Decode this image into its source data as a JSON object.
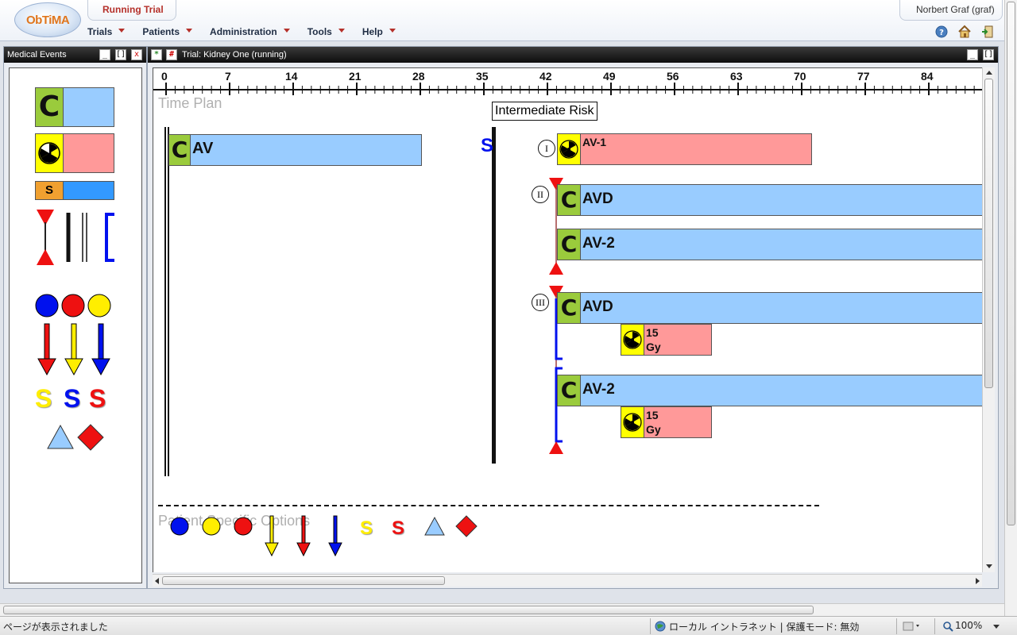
{
  "app": {
    "logo_text": "ObTiMA",
    "active_tab": "Running Trial",
    "user": "Norbert Graf (graf)"
  },
  "menu": [
    {
      "label": "Trials"
    },
    {
      "label": "Patients"
    },
    {
      "label": "Administration"
    },
    {
      "label": "Tools"
    },
    {
      "label": "Help"
    }
  ],
  "header_icons": [
    "help-icon",
    "home-icon",
    "logout-icon"
  ],
  "left_panel": {
    "title": "Medical Events",
    "buttons": {
      "minimize": "_",
      "restore": "[]",
      "close": "x"
    }
  },
  "main_panel": {
    "title": "Trial: Kidney One (running)",
    "add_button": "*",
    "hash_button": "#",
    "buttons": {
      "minimize": "_",
      "restore": "[]"
    }
  },
  "timeline": {
    "ticks": [
      "0",
      "7",
      "14",
      "21",
      "28",
      "35",
      "42",
      "49",
      "56",
      "63",
      "70",
      "77",
      "84"
    ],
    "section_title": "Time Plan",
    "risk_label": "Intermediate Risk",
    "s_marker": "S",
    "chemo_letter": "C",
    "av_label": "AV",
    "branches": [
      {
        "roman": "I",
        "label": "AV-1"
      },
      {
        "roman": "II",
        "label_1": "AVD",
        "label_2": "AV-2"
      },
      {
        "roman": "III",
        "label_1": "AVD",
        "label_2": "AV-2",
        "dose_value": "15",
        "dose_unit": "Gy"
      }
    ],
    "patient_options_title": "Patient Specific Options",
    "s_letters": [
      "S",
      "S"
    ]
  },
  "palette": {
    "chemo_letter": "C",
    "s_letter": "S",
    "s_letters": [
      "S",
      "S",
      "S"
    ]
  },
  "colors": {
    "chemo": "#99ccff",
    "chemo_label": "#9acb3c",
    "radio": "#ff9999",
    "radiation_icon": "#ffff00",
    "surgery_label": "#f0a030",
    "surgery_bar": "#3399ff",
    "red": "#ee1111",
    "blue": "#0000ee",
    "yellow": "#ffee00"
  },
  "statusbar": {
    "left": "ページが表示されました",
    "zone": "ローカル イントラネット | 保護モード: 無効",
    "zoom": "100%"
  }
}
